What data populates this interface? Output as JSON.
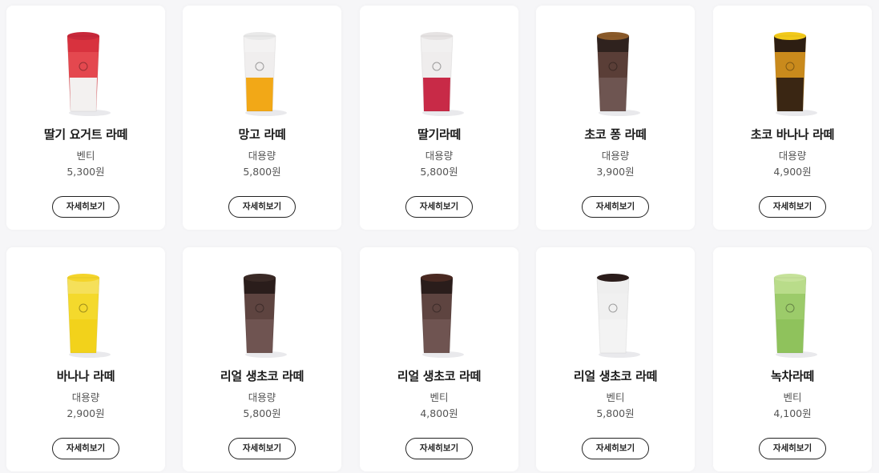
{
  "products": [
    {
      "name": "딸기 요거트 라떼",
      "size": "벤티",
      "price": "5,300원",
      "button": "자세히보기",
      "cup": {
        "base": "#f3f1f0",
        "mid": "#e4484f",
        "top": "#d8323e",
        "topping": "#c8283a"
      }
    },
    {
      "name": "망고 라떼",
      "size": "대용량",
      "price": "5,800원",
      "button": "자세히보기",
      "cup": {
        "base": "#f2a817",
        "mid": "#f0eeee",
        "top": "#f3f2f2",
        "topping": "#e9e9e9"
      }
    },
    {
      "name": "딸기라떼",
      "size": "대용량",
      "price": "5,800원",
      "button": "자세히보기",
      "cup": {
        "base": "#c82a47",
        "mid": "#efeded",
        "top": "#f1f0f0",
        "topping": "#e6e3e3"
      }
    },
    {
      "name": "초코 퐁 라떼",
      "size": "대용량",
      "price": "3,900원",
      "button": "자세히보기",
      "cup": {
        "base": "#6e5551",
        "mid": "#5a3e37",
        "top": "#2f221e",
        "topping": "#8a5a2a"
      }
    },
    {
      "name": "초코 바나나 라떼",
      "size": "대용량",
      "price": "4,900원",
      "button": "자세히보기",
      "cup": {
        "base": "#3a2613",
        "mid": "#c98a1c",
        "top": "#2d1e12",
        "topping": "#f2c91a"
      }
    },
    {
      "name": "바나나 라떼",
      "size": "대용량",
      "price": "2,900원",
      "button": "자세히보기",
      "cup": {
        "base": "#f2d21b",
        "mid": "#f4d92c",
        "top": "#f5e05a",
        "topping": "#f4d42a"
      }
    },
    {
      "name": "리얼 생초코 라떼",
      "size": "대용량",
      "price": "5,800원",
      "button": "자세히보기",
      "cup": {
        "base": "#6f5451",
        "mid": "#5e4440",
        "top": "#2a1d1b",
        "topping": "#3a2a26"
      }
    },
    {
      "name": "리얼 생초코 라떼",
      "size": "벤티",
      "price": "4,800원",
      "button": "자세히보기",
      "cup": {
        "base": "#6f5451",
        "mid": "#5e4440",
        "top": "#2a1d1b",
        "topping": "#4a2a22"
      }
    },
    {
      "name": "리얼 생초코 라떼",
      "size": "벤티",
      "price": "5,800원",
      "button": "자세히보기",
      "cup": {
        "base": "#f3f3f3",
        "mid": "#f0f0f0",
        "top": "#eeeeee",
        "topping": "#2b1d1b"
      }
    },
    {
      "name": "녹차라떼",
      "size": "벤티",
      "price": "4,100원",
      "button": "자세히보기",
      "cup": {
        "base": "#8fc25c",
        "mid": "#9ccb6a",
        "top": "#b9dc8a",
        "topping": "#c6e29a"
      }
    }
  ]
}
